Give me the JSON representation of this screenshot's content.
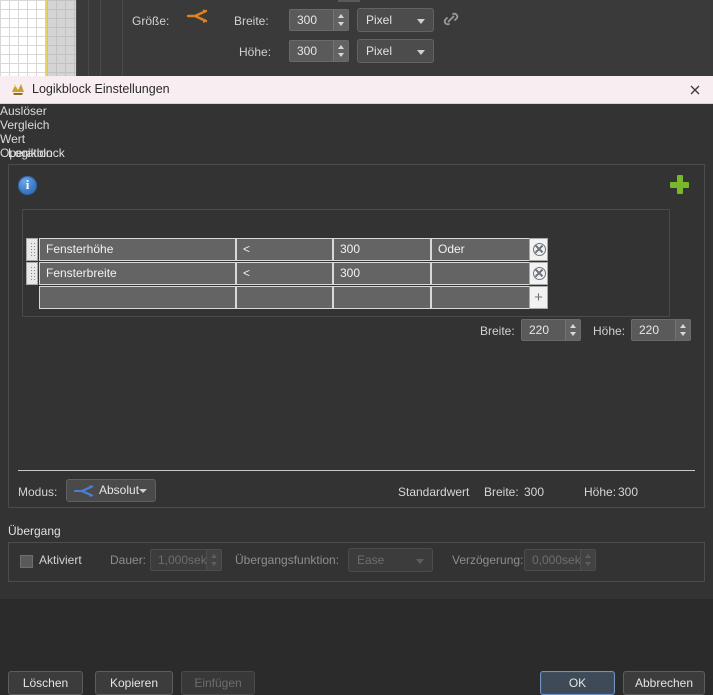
{
  "background_app": {
    "size_label": "Größe:",
    "logic_icon": "logic-branch-icon",
    "link_icon": "chain-link-icon",
    "width_label": "Breite:",
    "width_value": "300",
    "width_unit": "Pixel",
    "height_label": "Höhe:",
    "height_value": "300",
    "height_unit": "Pixel"
  },
  "dialog": {
    "title": "Logikblock Einstellungen",
    "title_icon": "app-icon",
    "close_icon": "close-icon",
    "group_label": "Logikblock",
    "info_icon": "info-icon",
    "add_icon": "add-plus-icon",
    "delete_icon": "delete-cross-icon",
    "table": {
      "columns": [
        "Auslöser",
        "Vergleich",
        "Wert",
        "Operation"
      ],
      "rows": [
        {
          "trigger": "Fensterhöhe",
          "comparison": "<",
          "value": "300",
          "operation": "Oder",
          "row_action": "remove-row-icon"
        },
        {
          "trigger": "Fensterbreite",
          "comparison": "<",
          "value": "300",
          "operation": "",
          "row_action": "remove-row-icon"
        },
        {
          "trigger": "",
          "comparison": "",
          "value": "",
          "operation": "",
          "row_action": "add-row-icon"
        }
      ]
    },
    "result": {
      "width_label": "Breite:",
      "width_value": "220",
      "height_label": "Höhe:",
      "height_value": "220"
    },
    "mode": {
      "label": "Modus:",
      "icon": "logic-branch-icon",
      "value": "Absolut"
    },
    "defaults": {
      "caption": "Standardwert",
      "width_label": "Breite:",
      "width_value": "300",
      "height_label": "Höhe:",
      "height_value": "300"
    },
    "transition": {
      "group_label": "Übergang",
      "enabled_label": "Aktiviert",
      "enabled_checked": false,
      "duration_label": "Dauer:",
      "duration_value": "1,000sek",
      "function_label": "Übergangsfunktion:",
      "function_value": "Ease",
      "delay_label": "Verzögerung:",
      "delay_value": "0,000sek"
    },
    "buttons": {
      "delete": "Löschen",
      "copy": "Kopieren",
      "paste": "Einfügen",
      "ok": "OK",
      "cancel": "Abbrechen"
    }
  },
  "colors": {
    "titlebar_bg": "#f8eef2",
    "dialog_bg": "#333333",
    "accent_green": "#76b82a",
    "accent_orange": "#e8621f",
    "accent_blue": "#3b78c4",
    "primary_border": "#6f93c6"
  }
}
